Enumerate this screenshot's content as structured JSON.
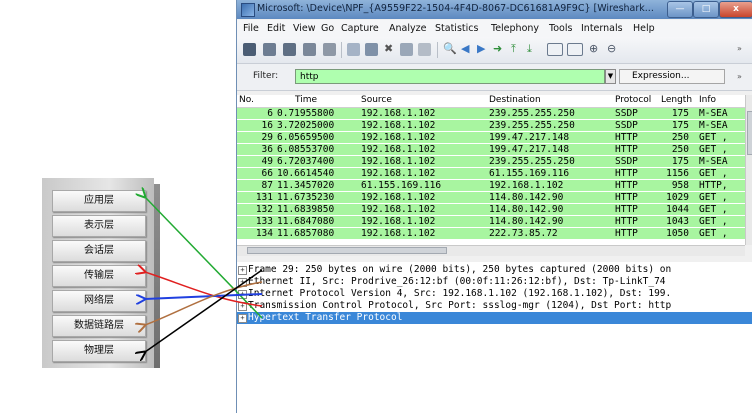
{
  "osi_stack": {
    "layers": [
      "应用层",
      "表示层",
      "会话层",
      "传输层",
      "网络层",
      "数据链路层",
      "物理层"
    ]
  },
  "window": {
    "title": "Microsoft: \\Device\\NPF_{A9559F22-1504-4F4D-8067-DC61681A9F9C}  [Wireshark...",
    "buttons": {
      "min": "—",
      "max": "□",
      "close": "x"
    }
  },
  "menu": [
    "File",
    "Edit",
    "View",
    "Go",
    "Capture",
    "Analyze",
    "Statistics",
    "Telephony",
    "Tools",
    "Internals",
    "Help"
  ],
  "filter": {
    "label": "Filter:",
    "value": "http",
    "expression": "Expression...",
    "more": "»"
  },
  "packet_list": {
    "columns": [
      "No.",
      "Time",
      "Source",
      "Destination",
      "Protocol",
      "Length",
      "Info"
    ],
    "rows": [
      [
        "6",
        "0.71955800",
        "192.168.1.102",
        "239.255.255.250",
        "SSDP",
        "175",
        "M-SEA"
      ],
      [
        "16",
        "3.72025000",
        "192.168.1.102",
        "239.255.255.250",
        "SSDP",
        "175",
        "M-SEA"
      ],
      [
        "29",
        "6.05659500",
        "192.168.1.102",
        "199.47.217.148",
        "HTTP",
        "250",
        "GET ,"
      ],
      [
        "36",
        "6.08553700",
        "192.168.1.102",
        "199.47.217.148",
        "HTTP",
        "250",
        "GET ,"
      ],
      [
        "49",
        "6.72037400",
        "192.168.1.102",
        "239.255.255.250",
        "SSDP",
        "175",
        "M-SEA"
      ],
      [
        "66",
        "10.6614540",
        "192.168.1.102",
        "61.155.169.116",
        "HTTP",
        "1156",
        "GET ,"
      ],
      [
        "87",
        "11.3457020",
        "61.155.169.116",
        "192.168.1.102",
        "HTTP",
        "958",
        "HTTP,"
      ],
      [
        "131",
        "11.6735230",
        "192.168.1.102",
        "114.80.142.90",
        "HTTP",
        "1029",
        "GET ,"
      ],
      [
        "132",
        "11.6839850",
        "192.168.1.102",
        "114.80.142.90",
        "HTTP",
        "1044",
        "GET ,"
      ],
      [
        "133",
        "11.6847080",
        "192.168.1.102",
        "114.80.142.90",
        "HTTP",
        "1043",
        "GET ,"
      ],
      [
        "134",
        "11.6857080",
        "192.168.1.102",
        "222.73.85.72",
        "HTTP",
        "1050",
        "GET ,"
      ]
    ]
  },
  "details": [
    {
      "text": "Frame 29: 250 bytes on wire (2000 bits), 250 bytes captured (2000 bits) on",
      "selected": false
    },
    {
      "text": "Ethernet II, Src: Prodrive_26:12:bf (00:0f:11:26:12:bf), Dst: Tp-LinkT_74",
      "selected": false
    },
    {
      "text": "Internet Protocol Version 4, Src: 192.168.1.102 (192.168.1.102), Dst: 199.",
      "selected": false
    },
    {
      "text": "Transmission Control Protocol, Src Port: ssslog-mgr (1204), Dst Port: http",
      "selected": false
    },
    {
      "text": "Hypertext Transfer Protocol",
      "selected": true
    }
  ],
  "arrow_colors": {
    "application": "#22aa33",
    "transport": "#e02020",
    "network": "#2040e0",
    "datalink": "#b07040",
    "physical": "#000000"
  }
}
